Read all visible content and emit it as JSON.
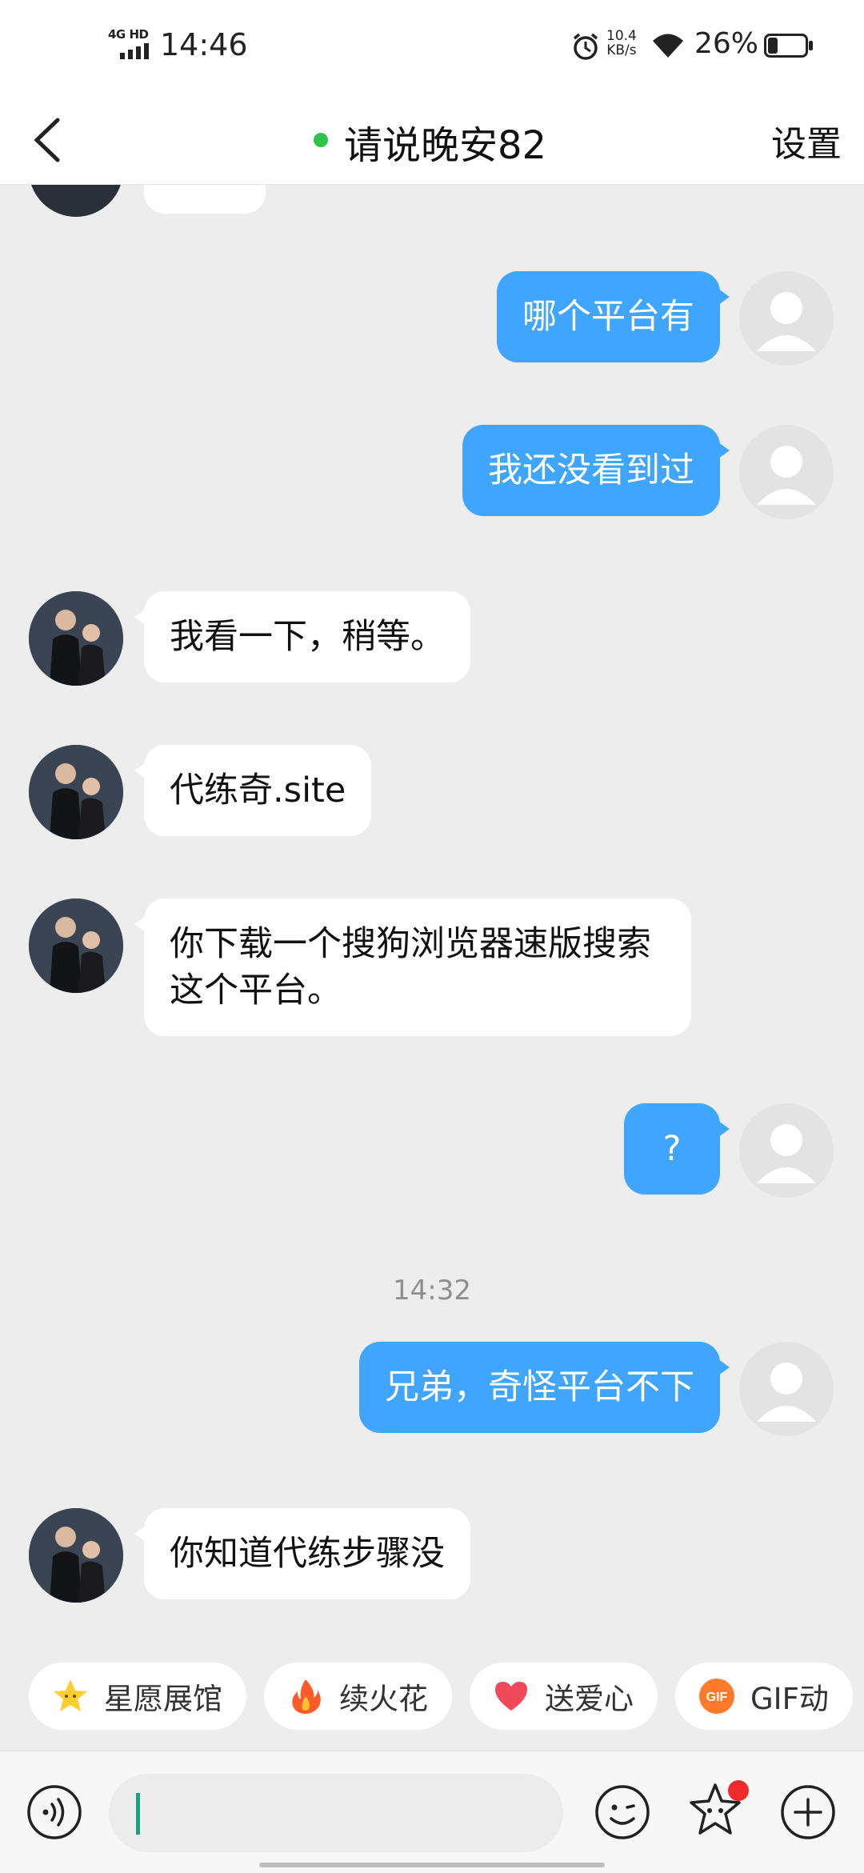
{
  "status_bar": {
    "network": "4G HD",
    "time": "14:46",
    "speed_value": "10.4",
    "speed_unit": "KB/s",
    "battery": "26%",
    "battery_level": 0.26
  },
  "header": {
    "title": "请说晚安82",
    "settings_label": "设置",
    "online_color": "#30c24a"
  },
  "messages": [
    {
      "from": "me",
      "text": "哪个平台有"
    },
    {
      "from": "me",
      "text": "我还没看到过"
    },
    {
      "from": "other",
      "text": "我看一下，稍等。"
    },
    {
      "from": "other",
      "text": "代练奇.site"
    },
    {
      "from": "other",
      "text": "你下载一个搜狗浏览器速版搜索这个平台。"
    },
    {
      "from": "me",
      "text": "?"
    },
    {
      "from": "me",
      "text": "兄弟，奇怪平台不下"
    },
    {
      "from": "other",
      "text": "你知道代练步骤没"
    }
  ],
  "timestamp": "14:32",
  "chips": [
    {
      "label": "星愿展馆",
      "icon": "star-icon"
    },
    {
      "label": "续火花",
      "icon": "fire-icon"
    },
    {
      "label": "送爱心",
      "icon": "heart-icon"
    },
    {
      "label": "GIF动",
      "icon": "gif-icon"
    }
  ],
  "colors": {
    "bubble_out": "#3fa5ff",
    "bubble_in": "#ffffff",
    "background": "#ededed"
  }
}
